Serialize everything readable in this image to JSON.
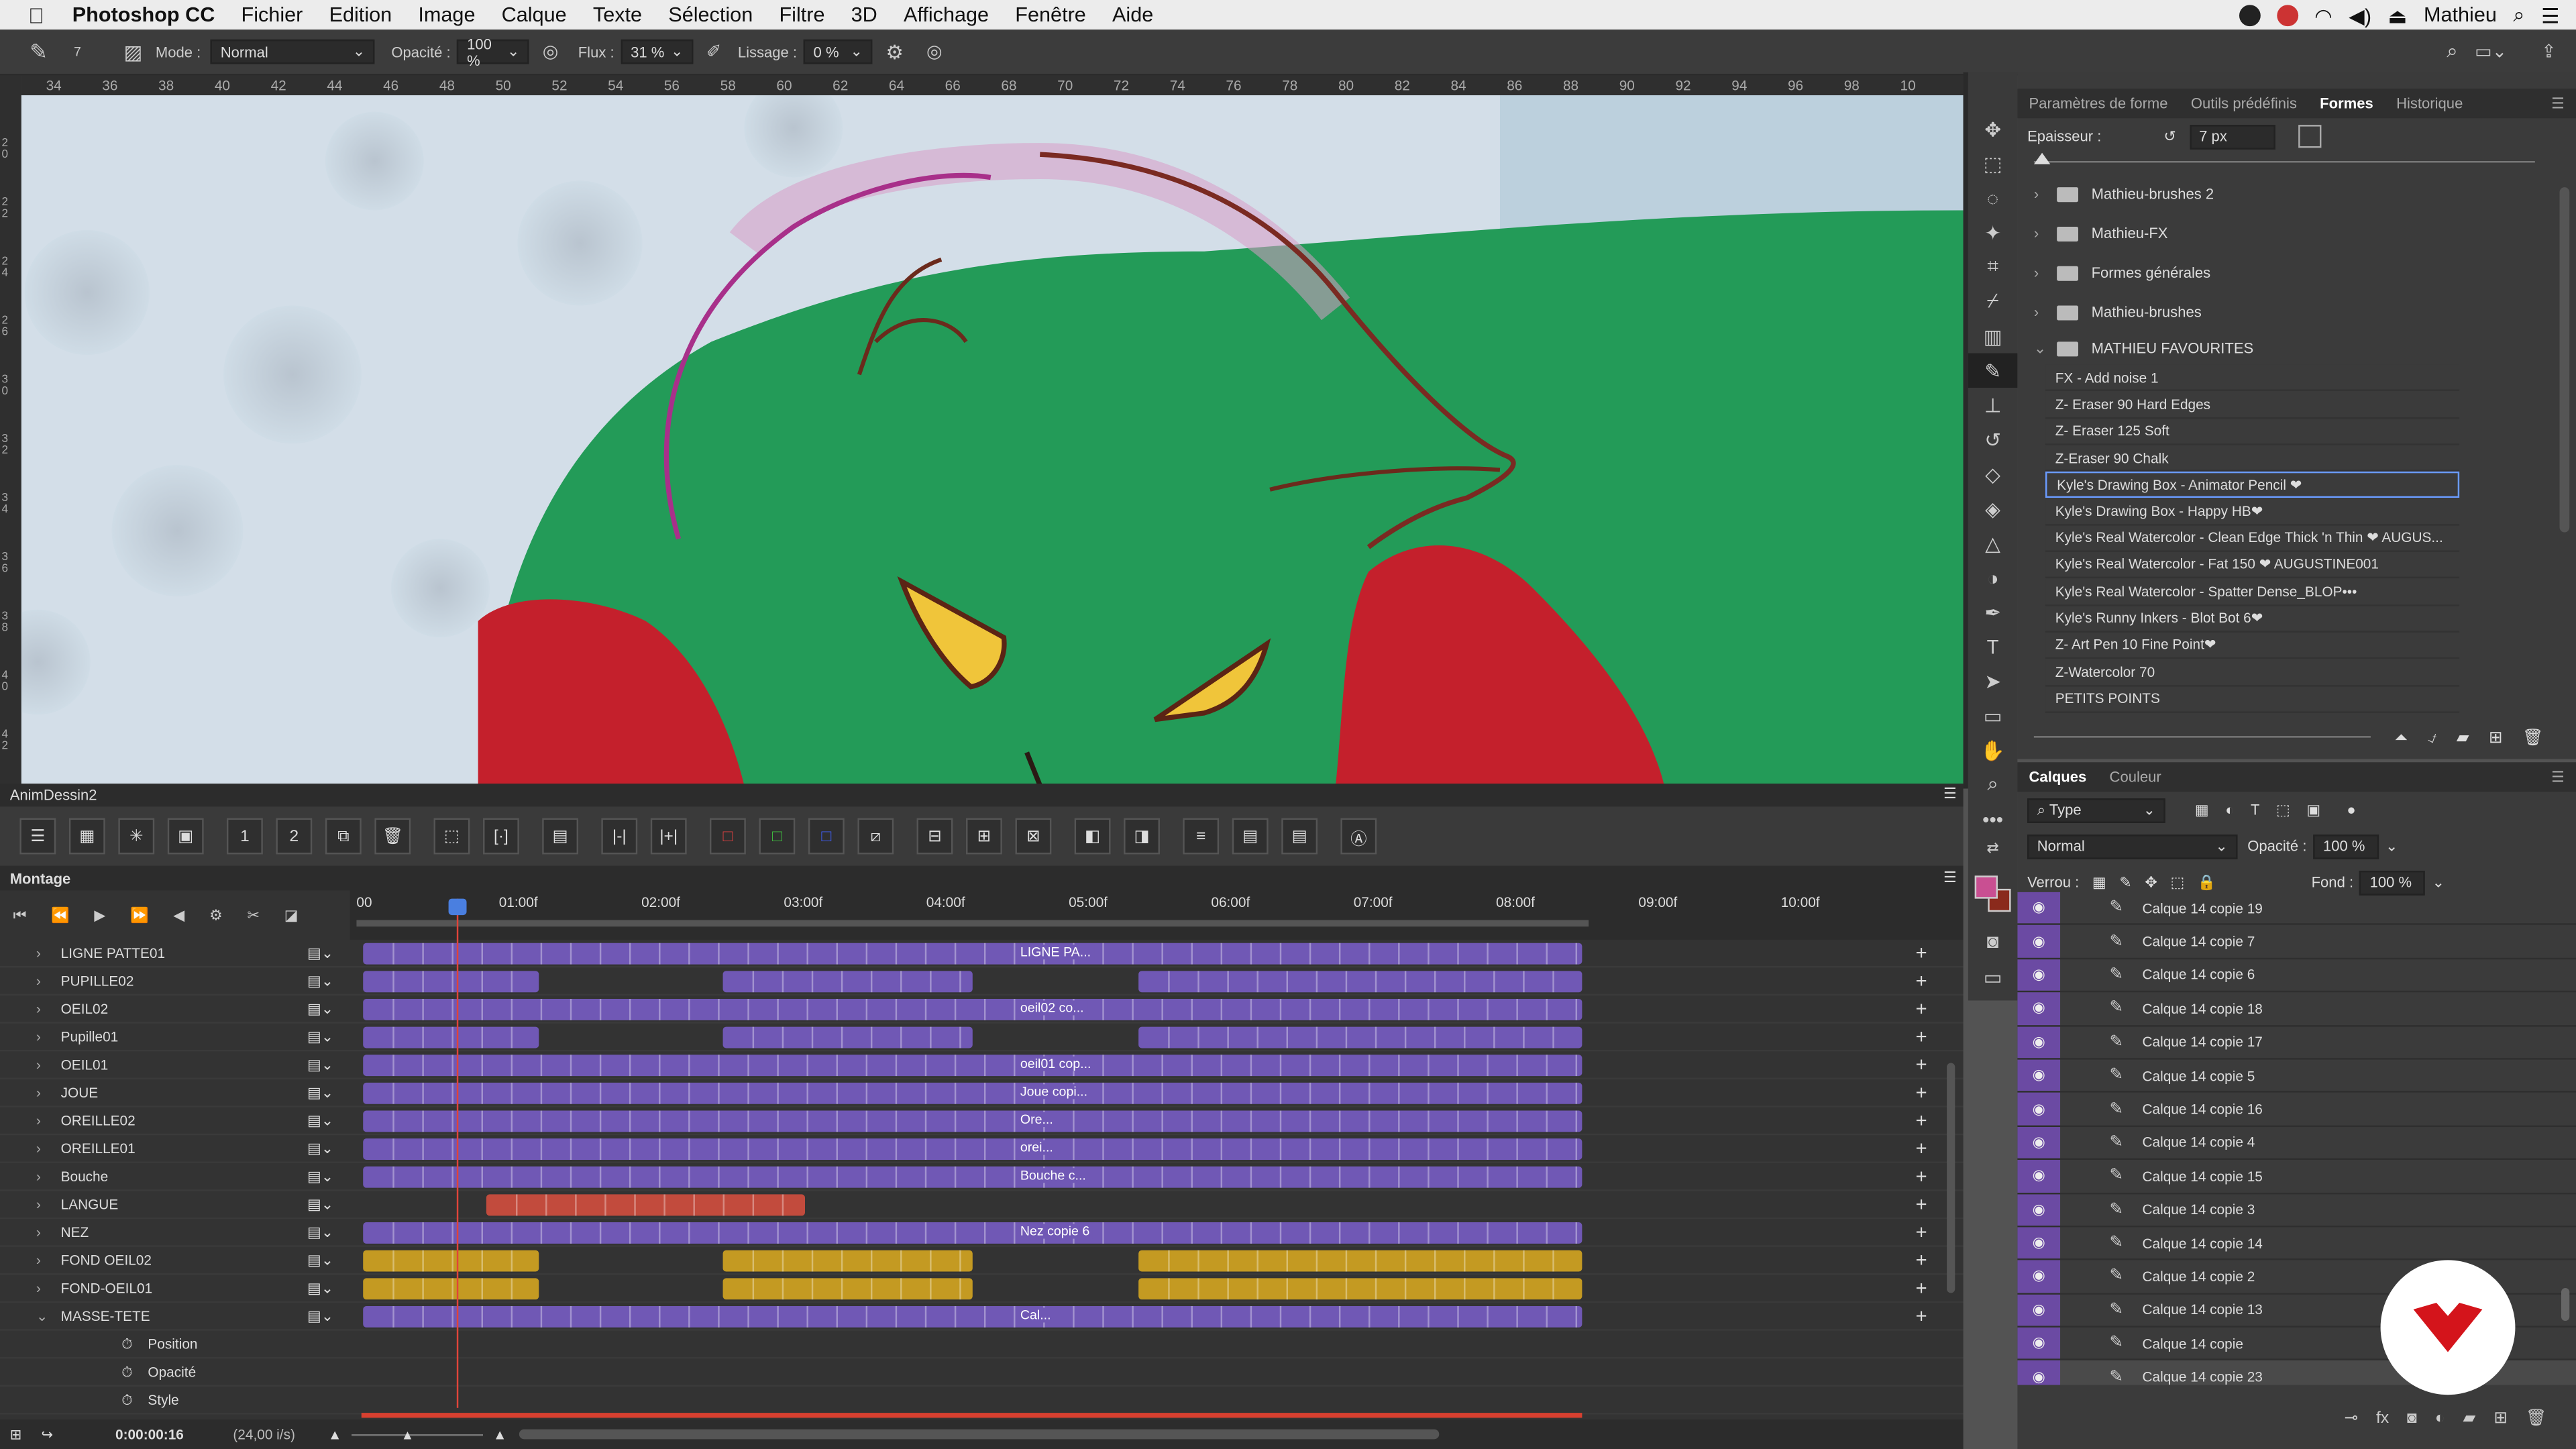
{
  "menubar": {
    "app": "Photoshop CC",
    "items": [
      "Fichier",
      "Edition",
      "Image",
      "Calque",
      "Texte",
      "Sélection",
      "Filtre",
      "3D",
      "Affichage",
      "Fenêtre",
      "Aide"
    ],
    "user": "Mathieu"
  },
  "options": {
    "size": "7",
    "mode_label": "Mode :",
    "mode_value": "Normal",
    "opacity_label": "Opacité :",
    "opacity_value": "100 %",
    "flux_label": "Flux :",
    "flux_value": "31 %",
    "lissage_label": "Lissage :",
    "lissage_value": "0 %"
  },
  "ruler": {
    "ticks": [
      "34",
      "36",
      "38",
      "40",
      "42",
      "44",
      "46",
      "48",
      "50",
      "52",
      "54",
      "56",
      "58",
      "60",
      "62",
      "64",
      "66",
      "68",
      "70",
      "72",
      "74",
      "76",
      "78",
      "80",
      "82",
      "84",
      "86",
      "88",
      "90",
      "92",
      "94",
      "96",
      "98",
      "10"
    ],
    "left_ticks": [
      "2 0",
      "2 2",
      "2 4",
      "2 6",
      "3 0",
      "3 2",
      "3 4",
      "3 6",
      "3 8",
      "4 0",
      "4 2"
    ]
  },
  "right_panel": {
    "tabs": [
      "Paramètres de forme",
      "Outils prédéfinis",
      "Formes",
      "Historique"
    ],
    "active_tab": "Formes",
    "thickness_label": "Epaisseur :",
    "thickness_value": "7 px",
    "folders": [
      {
        "name": "Mathieu-brushes  2",
        "open": false
      },
      {
        "name": "Mathieu-FX",
        "open": false
      },
      {
        "name": "Formes générales",
        "open": false
      },
      {
        "name": "Mathieu-brushes",
        "open": false
      },
      {
        "name": "MATHIEU FAVOURITES",
        "open": true
      }
    ],
    "brushes": [
      "FX - Add noise 1",
      "Z- Eraser 90 Hard Edges",
      "Z- Eraser 125 Soft",
      "Z-Eraser 90 Chalk",
      "Kyle's Drawing Box - Animator Pencil ❤",
      "Kyle's Drawing Box - Happy HB❤",
      "Kyle's Real Watercolor - Clean Edge Thick 'n Thin ❤ AUGUS...",
      "Kyle's Real Watercolor - Fat 150 ❤ AUGUSTINE001",
      "Kyle's Real Watercolor - Spatter Dense_BLOP•••",
      "Kyle's Runny Inkers - Blot Bot 6❤",
      "Z- Art Pen 10 Fine Point❤",
      "Z-Watercolor 70",
      "PETITS POINTS"
    ],
    "selected_brush_index": 4
  },
  "layers_panel": {
    "tabs": [
      "Calques",
      "Couleur"
    ],
    "filter_label": "Type",
    "blend_mode": "Normal",
    "opacity_label": "Opacité :",
    "opacity_value": "100 %",
    "lock_label": "Verrou :",
    "fill_label": "Fond :",
    "fill_value": "100 %",
    "layers": [
      "Calque 14 copie 19",
      "Calque 14 copie 7",
      "Calque 14 copie 6",
      "Calque 14 copie 18",
      "Calque 14 copie 17",
      "Calque 14 copie 5",
      "Calque 14 copie 16",
      "Calque 14 copie 4",
      "Calque 14 copie 15",
      "Calque 14 copie 3",
      "Calque 14 copie 14",
      "Calque 14 copie 2",
      "Calque 14 copie 13",
      "Calque 14 copie",
      "Calque 14 copie 23"
    ]
  },
  "anim_panel": {
    "title": "AnimDessin2"
  },
  "timeline": {
    "title": "Montage",
    "time_labels": [
      "00",
      "01:00f",
      "02:00f",
      "03:00f",
      "04:00f",
      "05:00f",
      "06:00f",
      "07:00f",
      "08:00f",
      "09:00f",
      "10:00f"
    ],
    "current_time": "0:00:00:16",
    "fps": "(24,00 i/s)",
    "playhead_fraction": 0.2,
    "tracks": [
      {
        "name": "LIGNE PATTE01",
        "color": "p",
        "label": "LIGNE PA..."
      },
      {
        "name": "PUPILLE02",
        "color": "p",
        "label": ""
      },
      {
        "name": "OEIL02",
        "color": "p",
        "label": "oeil02 co..."
      },
      {
        "name": "Pupille01",
        "color": "p",
        "label": ""
      },
      {
        "name": "OEIL01",
        "color": "p",
        "label": "oeil01 cop..."
      },
      {
        "name": "JOUE",
        "color": "p",
        "label": "Joue copi..."
      },
      {
        "name": "OREILLE02",
        "color": "p",
        "label": "Ore..."
      },
      {
        "name": "OREILLE01",
        "color": "p",
        "label": "orei..."
      },
      {
        "name": "Bouche",
        "color": "p",
        "label": "Bouche c..."
      },
      {
        "name": "LANGUE",
        "color": "r",
        "label": ""
      },
      {
        "name": "NEZ",
        "color": "p",
        "label": "Nez copie 6"
      },
      {
        "name": "FOND OEIL02",
        "color": "y",
        "label": ""
      },
      {
        "name": "FOND-OEIL01",
        "color": "y",
        "label": ""
      },
      {
        "name": "MASSE-TETE",
        "color": "p",
        "label": "Cal..."
      }
    ],
    "sub_props": [
      "Position",
      "Opacité",
      "Style"
    ]
  },
  "colors": {
    "fg": "#c94f92",
    "bg": "#8a2a1c",
    "clip_purple": "#7058b5",
    "clip_red": "#c24b3d",
    "clip_yellow": "#c49a22"
  }
}
